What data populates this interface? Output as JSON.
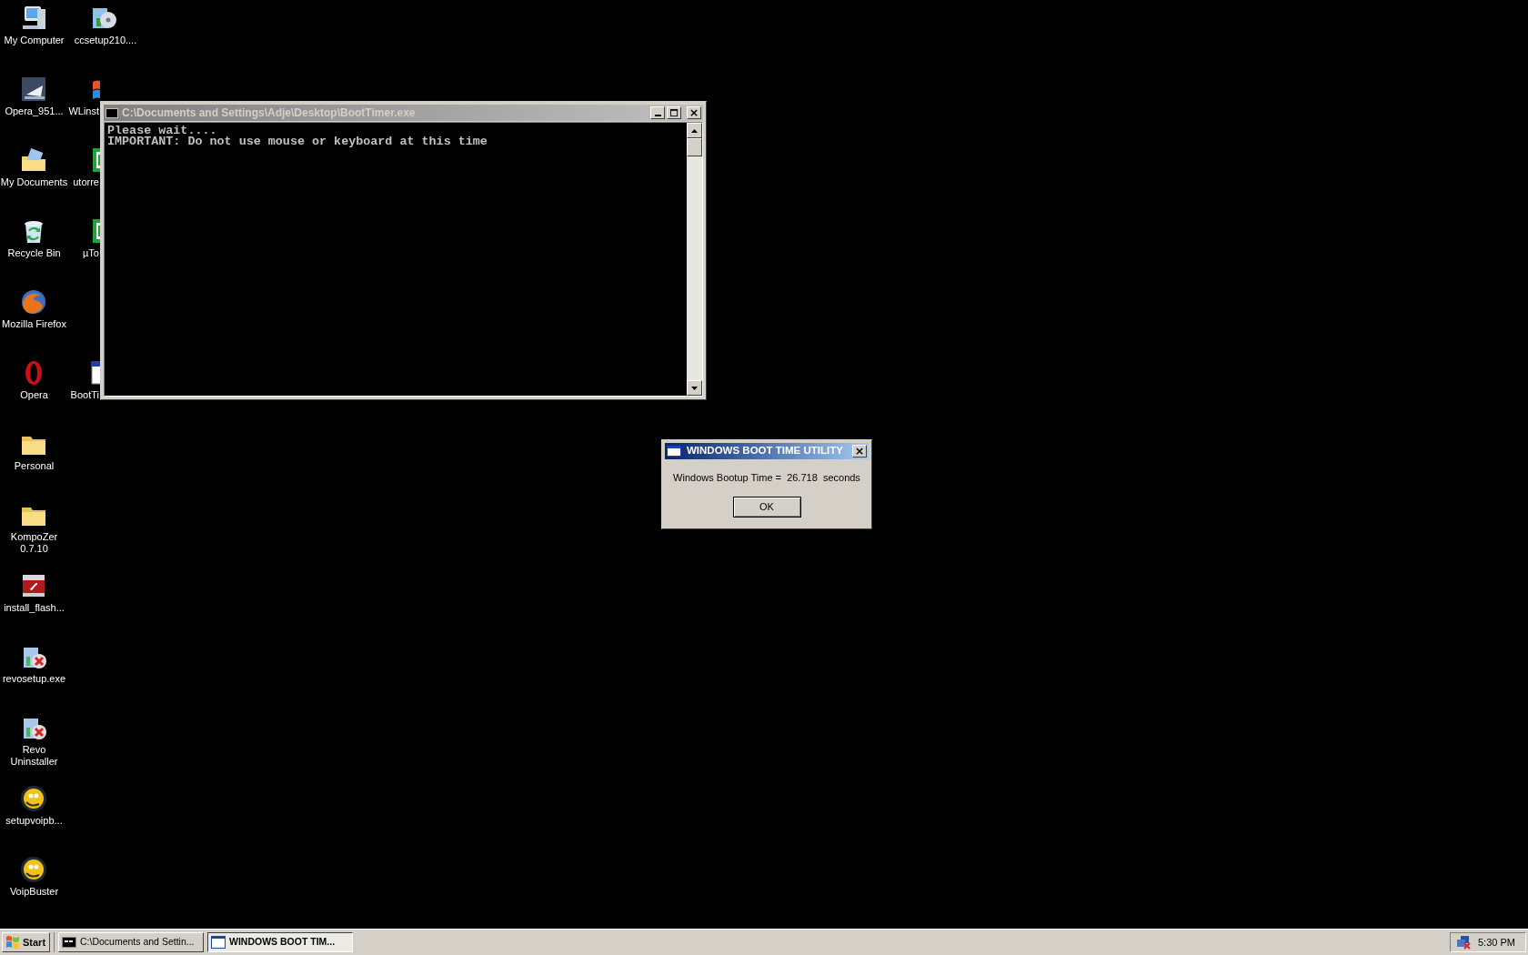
{
  "desktop": {
    "column_1": [
      {
        "label": "My Computer",
        "kind": "computer"
      },
      {
        "label": "Opera_951...",
        "kind": "sailboat"
      },
      {
        "label": "My Documents",
        "kind": "documents"
      },
      {
        "label": "Recycle Bin",
        "kind": "recycle"
      },
      {
        "label": "Mozilla Firefox",
        "kind": "firefox"
      },
      {
        "label": "Opera",
        "kind": "opera"
      },
      {
        "label": "Personal",
        "kind": "folder"
      },
      {
        "label": "KompoZer 0.7.10",
        "kind": "folder"
      },
      {
        "label": "install_flash...",
        "kind": "flash"
      },
      {
        "label": "revosetup.exe",
        "kind": "revo"
      },
      {
        "label": "Revo Uninstaller",
        "kind": "revo"
      },
      {
        "label": "setupvoipb...",
        "kind": "voip"
      },
      {
        "label": "VoipBuster",
        "kind": "voip"
      }
    ],
    "column_2": [
      {
        "label": "ccsetup210....",
        "kind": "disc"
      },
      {
        "label": "WLinst",
        "kind": "windows"
      },
      {
        "label": "utorre",
        "kind": "green"
      },
      {
        "label": "µTo",
        "kind": "green"
      },
      {
        "label": "BootTi",
        "kind": "app"
      }
    ]
  },
  "console_window": {
    "title": "C:\\Documents and Settings\\Adje\\Desktop\\BootTimer.exe",
    "active": false,
    "lines": [
      "Please wait....",
      "IMPORTANT: Do not use mouse or keyboard at this time"
    ]
  },
  "dialog": {
    "title": "WINDOWS BOOT TIME UTILITY",
    "active": true,
    "message": "Windows Bootup Time =  26.718  seconds",
    "button": "OK"
  },
  "taskbar": {
    "start": "Start",
    "tasks": [
      {
        "label": "C:\\Documents and Settin...",
        "kind": "console",
        "selected": false
      },
      {
        "label": "WINDOWS BOOT TIM...",
        "kind": "window",
        "selected": true
      }
    ],
    "clock": "5:30 PM"
  }
}
